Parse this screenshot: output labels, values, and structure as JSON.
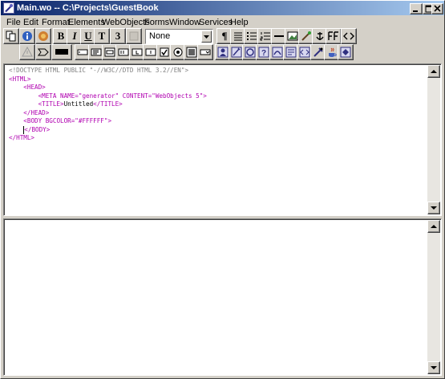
{
  "window": {
    "title": "Main.wo -- C:\\Projects\\GuestBook",
    "minimize_icon": "minimize-icon",
    "maximize_icon": "maximize-icon",
    "close_icon": "close-icon"
  },
  "menubar": {
    "items": [
      "File",
      "Edit",
      "Format",
      "Elements",
      "WebObjects",
      "Forms",
      "Window",
      "Services",
      "Help"
    ]
  },
  "toolbar1": {
    "buttons": [
      {
        "name": "copy-icon",
        "label": ""
      },
      {
        "name": "info-icon",
        "label": ""
      },
      {
        "name": "inspect-icon",
        "label": ""
      },
      {
        "name": "bold-button",
        "label": "B"
      },
      {
        "name": "italic-button",
        "label": "I"
      },
      {
        "name": "underline-button",
        "label": "U"
      },
      {
        "name": "teletype-button",
        "label": "T"
      },
      {
        "name": "font-size-button",
        "label": "3"
      },
      {
        "name": "color-button",
        "label": ""
      },
      {
        "name": "paragraph-button",
        "label": "¶"
      },
      {
        "name": "align-icon",
        "label": ""
      },
      {
        "name": "bullet-list-icon",
        "label": ""
      },
      {
        "name": "numbered-list-icon",
        "label": ""
      },
      {
        "name": "horizontal-rule-icon",
        "label": ""
      },
      {
        "name": "image-icon",
        "label": ""
      },
      {
        "name": "link-icon",
        "label": ""
      },
      {
        "name": "anchor-icon",
        "label": ""
      },
      {
        "name": "frames-icon",
        "label": ""
      },
      {
        "name": "code-toggle-icon",
        "label": ""
      }
    ],
    "style_select_value": "None"
  },
  "toolbar2": {
    "buttons": [
      "warning-icon",
      "arrow-shape-icon",
      "rectangle-icon",
      "text-field-icon",
      "browser-icon",
      "form-icon",
      "radio-group-icon",
      "submit-icon",
      "hidden-field-icon",
      "checkbox-icon",
      "radio-button-icon",
      "image-button-icon",
      "popup-icon",
      "person-icon",
      "component-icon",
      "conditional-icon",
      "help-icon",
      "repetition-icon",
      "string-icon",
      "custom-element-icon",
      "active-image-icon",
      "java-icon",
      "applet-icon"
    ]
  },
  "editor": {
    "lines": [
      {
        "indent": 0,
        "parts": [
          {
            "c": "doctype",
            "t": "<!DOCTYPE HTML PUBLIC \"-//W3C//DTD HTML 3.2//EN\">"
          }
        ]
      },
      {
        "indent": 0,
        "parts": [
          {
            "c": "tag",
            "t": "<HTML>"
          }
        ]
      },
      {
        "indent": 1,
        "parts": [
          {
            "c": "tag",
            "t": "<HEAD>"
          }
        ]
      },
      {
        "indent": 2,
        "parts": [
          {
            "c": "tag",
            "t": "<META NAME=\"generator\" CONTENT=\"WebObjects 5\">"
          }
        ]
      },
      {
        "indent": 2,
        "parts": [
          {
            "c": "tag",
            "t": "<TITLE>"
          },
          {
            "c": "text",
            "t": "Untitled"
          },
          {
            "c": "tag",
            "t": "</TITLE>"
          }
        ]
      },
      {
        "indent": 1,
        "parts": [
          {
            "c": "tag",
            "t": "</HEAD>"
          }
        ]
      },
      {
        "indent": 1,
        "parts": [
          {
            "c": "tag",
            "t": "<BODY BGCOLOR=\"#FFFFFF\">"
          }
        ]
      },
      {
        "indent": 1,
        "parts": [
          {
            "c": "tag",
            "t": "</BODY>"
          }
        ]
      },
      {
        "indent": 0,
        "parts": [
          {
            "c": "tag",
            "t": "</HTML>"
          }
        ]
      }
    ]
  },
  "colors": {
    "titlebar_start": "#0a246a",
    "titlebar_end": "#a6caf0",
    "tag": "#b000b0",
    "doctype": "#808080",
    "chrome": "#d4d0c8"
  }
}
